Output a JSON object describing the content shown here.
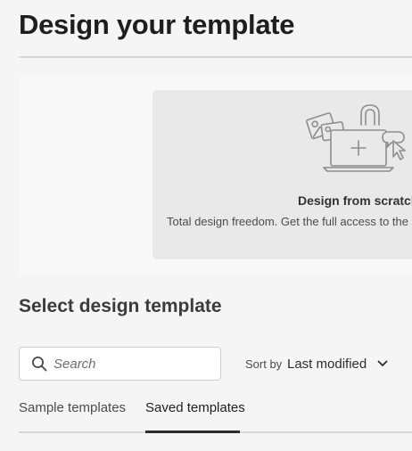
{
  "page": {
    "title": "Design your template"
  },
  "scratch_card": {
    "title": "Design from scratch",
    "description": "Total design freedom. Get the full access to the"
  },
  "section": {
    "title": "Select design template"
  },
  "search": {
    "placeholder": "Search",
    "value": ""
  },
  "sort": {
    "label": "Sort by",
    "value": "Last modified"
  },
  "tabs": [
    {
      "label": "Sample templates",
      "selected": false
    },
    {
      "label": "Saved templates",
      "selected": true
    }
  ],
  "icons": {
    "search": "search-icon",
    "sort_chevron": "chevron-down-icon",
    "illustration": "design-from-scratch-illustration"
  }
}
